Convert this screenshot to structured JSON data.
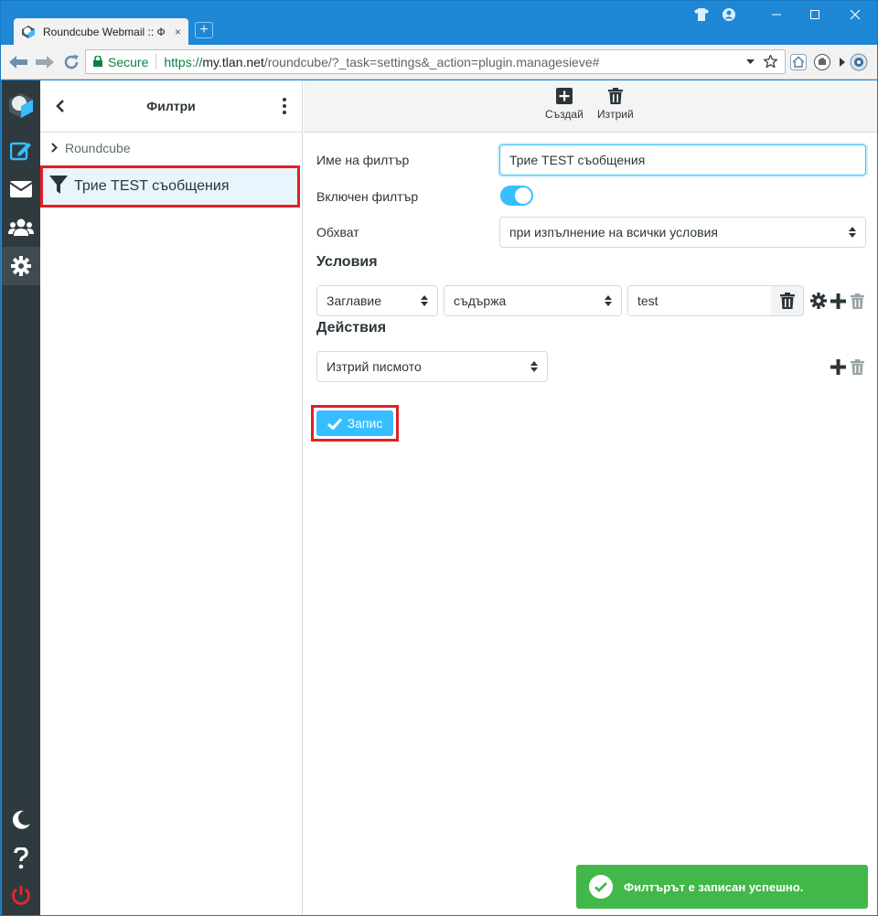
{
  "browser": {
    "tab_title": "Roundcube Webmail :: Ф",
    "tab_close": "×",
    "new_tab": "+",
    "secure_label": "Secure",
    "url_scheme": "https://",
    "url_host": "my.tlan.net",
    "url_rest": "/roundcube/?_task=settings&_action=plugin.managesieve#",
    "window_controls": [
      "minimize",
      "maximize",
      "close"
    ]
  },
  "rail": {
    "items": [
      {
        "name": "logo-icon"
      },
      {
        "name": "compose-icon"
      },
      {
        "name": "mail-icon"
      },
      {
        "name": "contacts-icon"
      },
      {
        "name": "settings-icon",
        "active": true
      }
    ],
    "bottom_items": [
      {
        "name": "dark-mode-icon"
      },
      {
        "name": "help-icon"
      },
      {
        "name": "logout-icon"
      }
    ]
  },
  "list": {
    "title": "Филтри",
    "set_name": "Roundcube",
    "filter_name": "Трие TEST съобщения"
  },
  "toolbar": {
    "create_label": "Създай",
    "delete_label": "Изтрий"
  },
  "form": {
    "name_label": "Име на филтър",
    "name_value": "Трие TEST съобщения",
    "enabled_label": "Включен филтър",
    "enabled": true,
    "scope_label": "Обхват",
    "scope_value": "при изпълнение на всички условия",
    "conditions_title": "Условия",
    "condition_header": "Заглавие",
    "condition_operator": "съдържа",
    "condition_value": "test",
    "actions_title": "Действия",
    "action_value": "Изтрий писмото",
    "save_label": "Запис"
  },
  "toast": {
    "message": "Филтърът е записан успешно."
  },
  "colors": {
    "accent": "#37beff",
    "rail": "#2f3a3f",
    "highlight_border": "#e21f26",
    "success": "#41b849",
    "window_blue": "#1e87d6"
  }
}
